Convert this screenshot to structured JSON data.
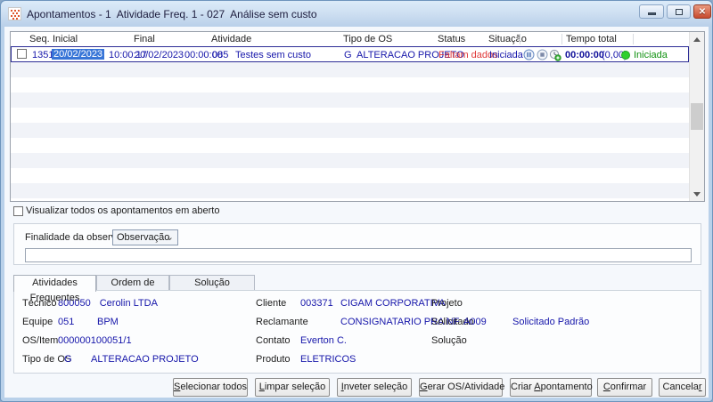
{
  "window": {
    "title": "Apontamentos - 1  Atividade Freq. 1 - 027  Análise sem custo"
  },
  "icons": {
    "app": "cigam-pixel-logo",
    "minimize": "minimize-bar",
    "maximize": "restore-box",
    "close": "✕",
    "pause": "pause-circle",
    "stop": "stop-circle",
    "add_time": "clock-plus",
    "chevron_down": "⌄",
    "status_dot": "green-dot",
    "scroll_up": "triangle-up",
    "scroll_down": "triangle-down"
  },
  "colors": {
    "value_navy": "#1616aa",
    "alert_red": "#e03a3a",
    "ok_green": "#2fd02f",
    "estado_green": "#129212",
    "selection_blue": "#3875d7"
  },
  "grid": {
    "headers": [
      "Seq.",
      "Inicial",
      "Final",
      "Atividade",
      "Tipo de OS",
      "Status",
      "Situação",
      "Tempo total"
    ],
    "row": {
      "seq": "13517",
      "inicial_data": "20/02/2023",
      "inicial_hora": "10:00:17",
      "final_data": "20/02/2023",
      "final_hora": "00:00:00",
      "atividade_cod": "085",
      "atividade_desc": "Testes sem custo",
      "tipo_os": "G  ALTERACAO PROJETO",
      "status": "Faltam dados",
      "situacao": "Iniciada",
      "tempo_total": "00:00:00",
      "tempo_decimal": "(0,00)",
      "estado": "Iniciada"
    }
  },
  "filter": {
    "visualizar_todos": "Visualizar todos os apontamentos em aberto"
  },
  "observacao": {
    "label": "Finalidade da observação",
    "selected": "Observação",
    "text": ""
  },
  "tabs": [
    {
      "label": "Atividades Frequentes"
    },
    {
      "label": "Ordem de Serviço"
    },
    {
      "label": "Solução"
    }
  ],
  "details": {
    "col1": [
      {
        "label": "Técnico",
        "code": "800050",
        "value": "Cerolin LTDA"
      },
      {
        "label": "Equipe",
        "code": "051",
        "value": "BPM"
      },
      {
        "label": "OS/Item",
        "code": "000000100051/1",
        "value": ""
      },
      {
        "label": "Tipo de OS",
        "code": "G",
        "value": "ALTERACAO PROJETO"
      }
    ],
    "col2": [
      {
        "label": "Cliente",
        "code": "003371",
        "value": "CIGAM CORPORATIVA"
      },
      {
        "label": "Reclamante",
        "code": "",
        "value": "CONSIGNATARIO PRA NF"
      },
      {
        "label": "Contato",
        "code": "Everton C.",
        "value": ""
      },
      {
        "label": "Produto",
        "code": "ELETRICOS",
        "value": ""
      }
    ],
    "col3": [
      {
        "label": "Projeto",
        "code": "",
        "value": ""
      },
      {
        "label": "Solicitado",
        "code": "A009",
        "value": "Solicitado Padrão"
      },
      {
        "label": "Solução",
        "code": "",
        "value": ""
      }
    ]
  },
  "buttons": [
    {
      "pre": "",
      "key": "S",
      "post": "elecionar todos"
    },
    {
      "pre": "",
      "key": "L",
      "post": "impar seleção"
    },
    {
      "pre": "",
      "key": "I",
      "post": "nveter seleção"
    },
    {
      "pre": "",
      "key": "G",
      "post": "erar OS/Atividade"
    },
    {
      "pre": "Criar ",
      "key": "A",
      "post": "pontamento"
    },
    {
      "pre": "",
      "key": "C",
      "post": "onfirmar"
    },
    {
      "pre": "Cancela",
      "key": "r",
      "post": ""
    }
  ]
}
